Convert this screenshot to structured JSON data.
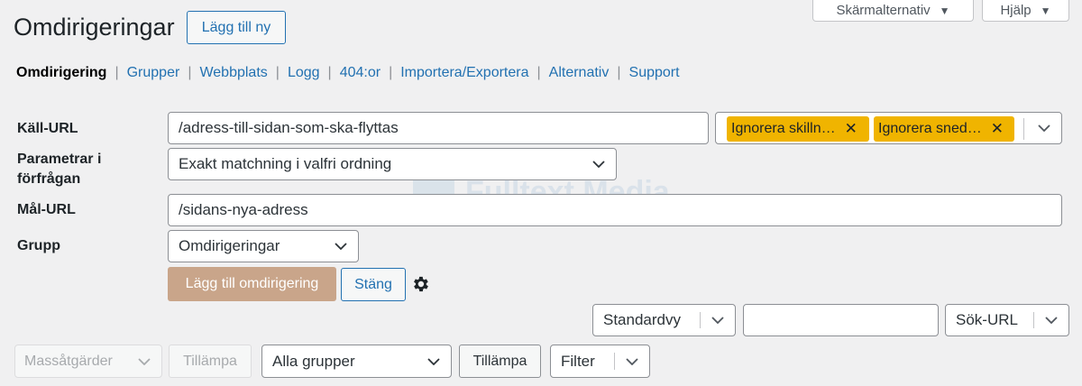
{
  "header": {
    "title": "Omdirigeringar",
    "add_new_label": "Lägg till ny",
    "screen_options_label": "Skärmalternativ",
    "help_label": "Hjälp"
  },
  "subnav": {
    "items": [
      {
        "label": "Omdirigering",
        "current": true
      },
      {
        "label": "Grupper"
      },
      {
        "label": "Webbplats"
      },
      {
        "label": "Logg"
      },
      {
        "label": "404:or"
      },
      {
        "label": "Importera/Exportera"
      },
      {
        "label": "Alternativ"
      },
      {
        "label": "Support"
      }
    ],
    "separator": "|"
  },
  "form": {
    "source_url_label": "Käll-URL",
    "source_url_value": "/adress-till-sidan-som-ska-flyttas",
    "match_tags": [
      "Ignorera skilln…",
      "Ignorera sned…"
    ],
    "tag_remove_glyph": "✕",
    "query_params_label": "Parametrar i förfrågan",
    "query_params_value": "Exakt matchning i valfri ordning",
    "target_url_label": "Mål-URL",
    "target_url_value": "/sidans-nya-adress",
    "group_label": "Grupp",
    "group_value": "Omdirigeringar",
    "add_redirect_label": "Lägg till omdirigering",
    "close_label": "Stäng"
  },
  "filters": {
    "view_select_value": "Standardvy",
    "search_input_value": "",
    "search_type_value": "Sök-URL"
  },
  "bulk": {
    "bulk_actions_value": "Massåtgärder",
    "apply_disabled_label": "Tillämpa",
    "groups_select_value": "Alla grupper",
    "apply_label": "Tillämpa",
    "filter_label": "Filter"
  },
  "watermark": {
    "text": "Fulltext Media"
  },
  "colors": {
    "background": "#f0f0f1",
    "link": "#2271b1",
    "tag": "#f0b400",
    "primary_disabled": "#c9a58a"
  },
  "icons": {
    "dropdown": "chevron-down-icon",
    "settings": "gear-icon",
    "tag_remove": "close-icon"
  }
}
